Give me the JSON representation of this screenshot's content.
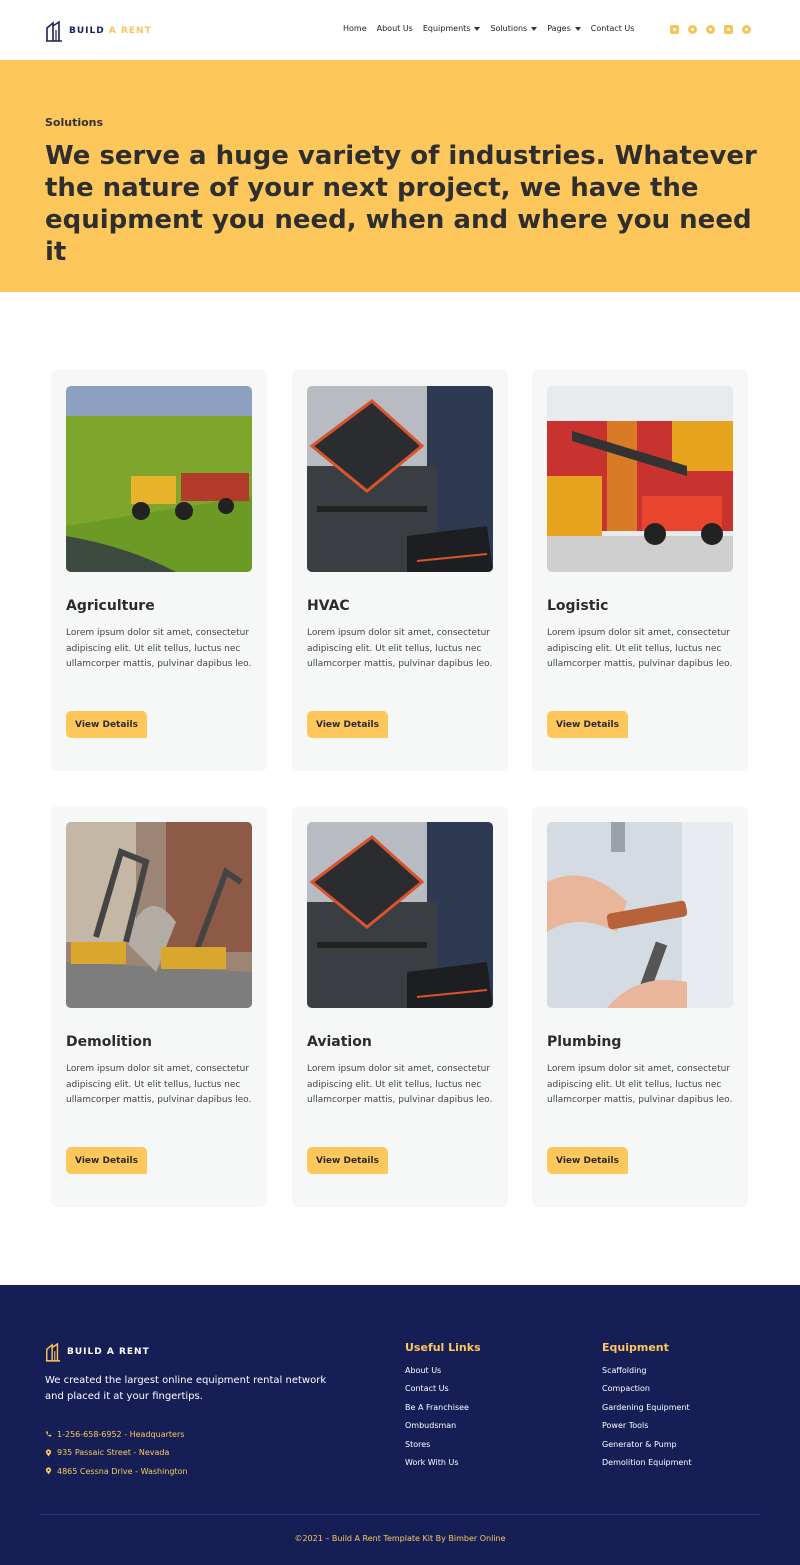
{
  "header": {
    "brand_main": "BUILD",
    "brand_accent": "A RENT",
    "nav": [
      {
        "label": "Home",
        "dropdown": false
      },
      {
        "label": "About Us",
        "dropdown": false
      },
      {
        "label": "Equipments",
        "dropdown": true
      },
      {
        "label": "Solutions",
        "dropdown": true
      },
      {
        "label": "Pages",
        "dropdown": true
      },
      {
        "label": "Contact Us",
        "dropdown": false
      }
    ],
    "socials": [
      "instagram-icon",
      "facebook-icon",
      "twitter-icon",
      "youtube-icon",
      "pinterest-icon"
    ]
  },
  "hero": {
    "kicker": "Solutions",
    "title": "We serve a huge variety of industries. Whatever the nature of your next project, we have the equipment you need, when and where you need it"
  },
  "cards": [
    {
      "title": "Agriculture",
      "desc": "Lorem ipsum dolor sit amet, consectetur adipiscing elit. Ut elit tellus, luctus nec ullamcorper mattis, pulvinar dapibus leo.",
      "button": "View Details",
      "image": "agriculture-harvester-image"
    },
    {
      "title": "HVAC",
      "desc": "Lorem ipsum dolor sit amet, consectetur adipiscing elit. Ut elit tellus, luctus nec ullamcorper mattis, pulvinar dapibus leo.",
      "button": "View Details",
      "image": "toolbox-image"
    },
    {
      "title": "Logistic",
      "desc": "Lorem ipsum dolor sit amet, consectetur adipiscing elit. Ut elit tellus, luctus nec ullamcorper mattis, pulvinar dapibus leo.",
      "button": "View Details",
      "image": "container-forklift-image"
    },
    {
      "title": "Demolition",
      "desc": "Lorem ipsum dolor sit amet, consectetur adipiscing elit. Ut elit tellus, luctus nec ullamcorper mattis, pulvinar dapibus leo.",
      "button": "View Details",
      "image": "excavators-image"
    },
    {
      "title": "Aviation",
      "desc": "Lorem ipsum dolor sit amet, consectetur adipiscing elit. Ut elit tellus, luctus nec ullamcorper mattis, pulvinar dapibus leo.",
      "button": "View Details",
      "image": "toolbox-image"
    },
    {
      "title": "Plumbing",
      "desc": "Lorem ipsum dolor sit amet, consectetur adipiscing elit. Ut elit tellus, luctus nec ullamcorper mattis, pulvinar dapibus leo.",
      "button": "View Details",
      "image": "pipe-plumbing-image"
    }
  ],
  "footer": {
    "brand": "BUILD A RENT",
    "about": "We created the largest online equipment rental network and placed it at your fingertips.",
    "contacts": [
      {
        "icon": "phone-icon",
        "text": "1-256-658-6952 - Headquarters"
      },
      {
        "icon": "location-pin-icon",
        "text": "935 Passaic Street - Nevada"
      },
      {
        "icon": "location-pin-icon",
        "text": "4865 Cessna Drive - Washington"
      }
    ],
    "useful_links_title": "Useful Links",
    "useful_links": [
      "About Us",
      "Contact Us",
      "Be A Franchisee",
      "Ombudsman",
      "Stores",
      "Work With Us"
    ],
    "equipment_title": "Equipment",
    "equipment_links": [
      "Scaffolding",
      "Compaction",
      "Gardening Equipment",
      "Power Tools",
      "Generator & Pump",
      "Demolition Equipment"
    ],
    "copyright": "©2021 – Build A Rent Template Kit By Bimber Online"
  },
  "colors": {
    "accent": "#fdc75b",
    "footer_bg": "#151f56",
    "card_bg": "#f6f7f7"
  }
}
